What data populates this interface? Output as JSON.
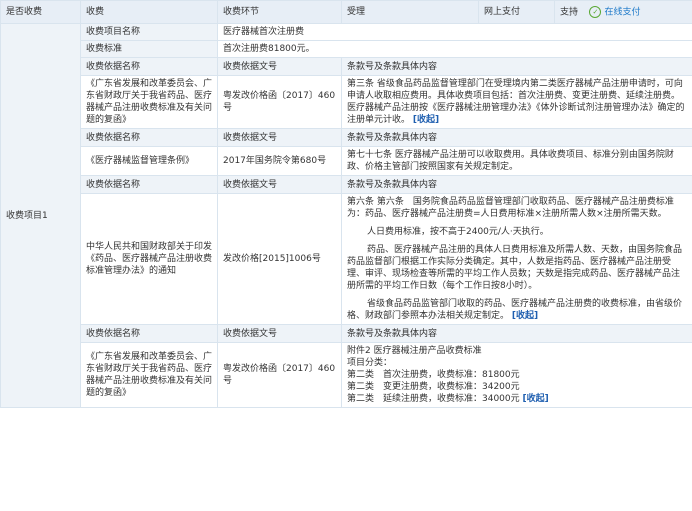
{
  "header": {
    "col1": "是否收费",
    "col2": "收费",
    "col3": "收费环节",
    "col4": "受理",
    "col5": "网上支付",
    "col6": "支持",
    "online_label": "在线支付"
  },
  "left_label": "收费项目1",
  "item_name_label": "收费项目名称",
  "item_name_value": "医疗器械首次注册费",
  "standard_label": "收费标准",
  "standard_value": "首次注册费81800元。",
  "basis_headers": {
    "name": "收费依据名称",
    "doc": "收费依据文号",
    "clause": "条款号及条款具体内容"
  },
  "collapse_label": "[收起]",
  "basis": [
    {
      "name": "《广东省发展和改革委员会、广东省财政厅关于我省药品、医疗器械产品注册收费标准及有关问题的复函》",
      "doc": "粤发改价格函〔2017〕460号",
      "clause": "第三条 省级食品药品监督管理部门在受理境内第二类医疗器械产品注册申请时，可向申请人收取相应费用。具体收费项目包括：首次注册费、变更注册费、延续注册费。医疗器械产品注册按《医疗器械注册管理办法》《体外诊断试剂注册管理办法》确定的注册单元计收。"
    },
    {
      "name": "《医疗器械监督管理条例》",
      "doc": "2017年国务院令第680号",
      "clause": "第七十七条 医疗器械产品注册可以收取费用。具体收费项目、标准分别由国务院财政、价格主管部门按照国家有关规定制定。"
    },
    {
      "name": "中华人民共和国财政部关于印发《药品、医疗器械产品注册收费标准管理办法》的通知",
      "doc": "发改价格[2015]1006号",
      "clause_paras": [
        "第六条 第六条　国务院食品药品监督管理部门收取药品、医疗器械产品注册费标准为：药品、医疗器械产品注册费=人日费用标准×注册所需人数×注册所需天数。",
        "人日费用标准，按不高于2400元/人·天执行。",
        "药品、医疗器械产品注册的具体人日费用标准及所需人数、天数，由国务院食品药品监督部门根据工作实际分类确定。其中，人数是指药品、医疗器械产品注册受理、审评、现场检查等所需的平均工作人员数；天数是指完成药品、医疗器械产品注册所需的平均工作日数（每个工作日按8小时）。",
        "省级食品药品监管部门收取的药品、医疗器械产品注册费的收费标准，由省级价格、财政部门参照本办法相关规定制定。"
      ]
    },
    {
      "name": "《广东省发展和改革委员会、广东省财政厅关于我省药品、医疗器械产品注册收费标准及有关问题的复函》",
      "doc": "粤发改价格函〔2017〕460号",
      "clause_lines": [
        "附件2 医疗器械注册产品收费标准",
        "项目分类：",
        "第二类　首次注册费，收费标准：81800元",
        "第二类　变更注册费，收费标准：34200元",
        "第二类　延续注册费，收费标准：34000元"
      ]
    }
  ]
}
